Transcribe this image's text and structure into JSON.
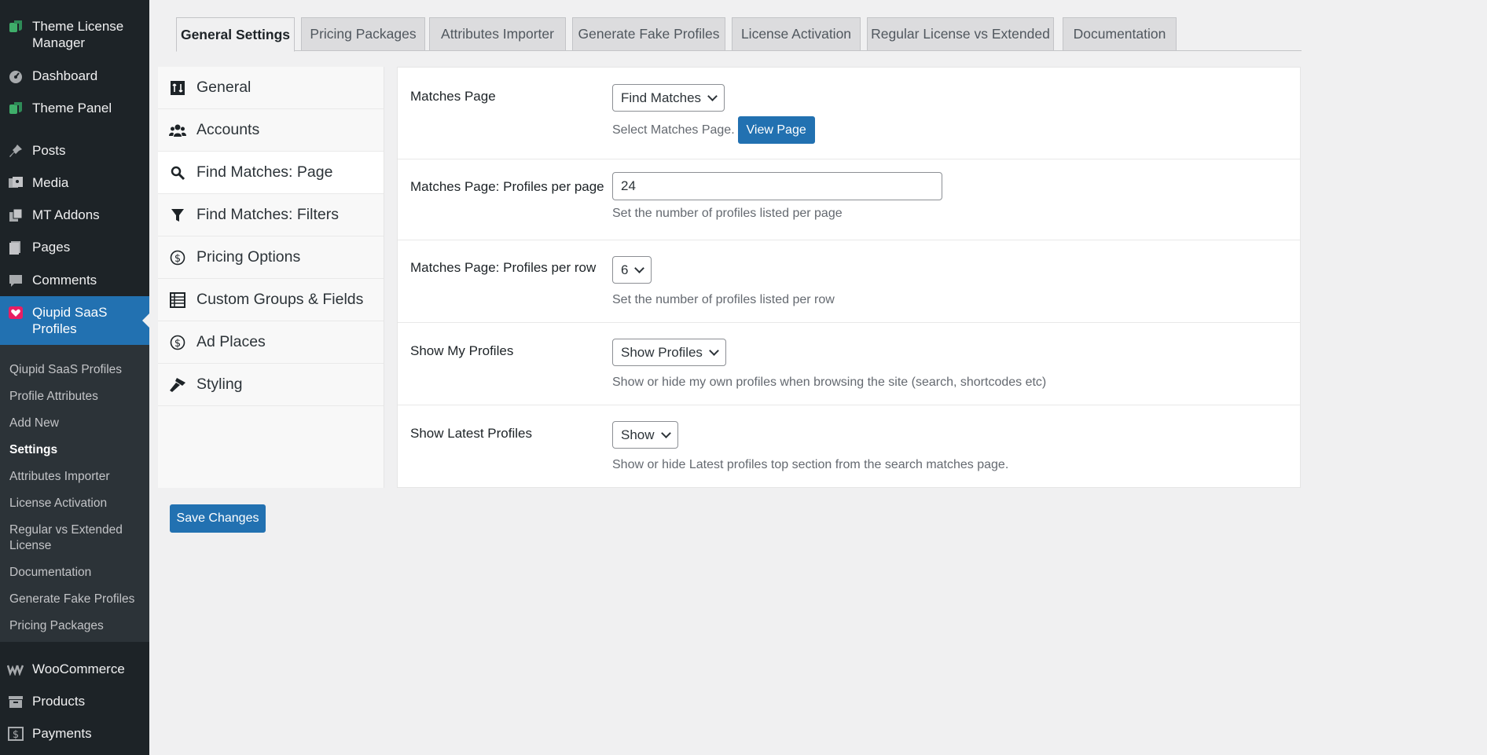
{
  "sidebar": {
    "top": [
      {
        "label": "Theme License Manager",
        "icon": "leaf-icon"
      },
      {
        "label": "Dashboard",
        "icon": "dashboard-icon"
      },
      {
        "label": "Theme Panel",
        "icon": "leaf-icon"
      },
      {
        "label": "Posts",
        "icon": "pin-icon"
      },
      {
        "label": "Media",
        "icon": "media-icon"
      },
      {
        "label": "MT Addons",
        "icon": "addons-icon"
      },
      {
        "label": "Pages",
        "icon": "pages-icon"
      },
      {
        "label": "Comments",
        "icon": "comment-icon"
      },
      {
        "label": "Qiupid SaaS Profiles",
        "icon": "heart-icon"
      }
    ],
    "submenu": [
      "Qiupid SaaS Profiles",
      "Profile Attributes",
      "Add New",
      "Settings",
      "Attributes Importer",
      "License Activation",
      "Regular vs Extended License",
      "Documentation",
      "Generate Fake Profiles",
      "Pricing Packages"
    ],
    "bottom": [
      {
        "label": "WooCommerce",
        "icon": "woo-icon"
      },
      {
        "label": "Products",
        "icon": "archive-icon"
      },
      {
        "label": "Payments",
        "icon": "dollar-box-icon"
      }
    ]
  },
  "tabs": [
    "General Settings",
    "Pricing Packages",
    "Attributes Importer",
    "Generate Fake Profiles",
    "License Activation",
    "Regular License vs Extended",
    "Documentation"
  ],
  "vnav": [
    "General",
    "Accounts",
    "Find Matches: Page",
    "Find Matches: Filters",
    "Pricing Options",
    "Custom Groups & Fields",
    "Ad Places",
    "Styling"
  ],
  "settings": {
    "matches_page": {
      "label": "Matches Page",
      "value": "Find Matches",
      "desc": "Select Matches Page.",
      "button": "View Page"
    },
    "per_page": {
      "label": "Matches Page: Profiles per page",
      "value": "24",
      "desc": "Set the number of profiles listed per page"
    },
    "per_row": {
      "label": "Matches Page: Profiles per row",
      "value": "6",
      "desc": "Set the number of profiles listed per row"
    },
    "show_my": {
      "label": "Show My Profiles",
      "value": "Show Profiles",
      "desc": "Show or hide my own profiles when browsing the site (search, shortcodes etc)"
    },
    "show_latest": {
      "label": "Show Latest Profiles",
      "value": "Show",
      "desc": "Show or hide Latest profiles top section from the search matches page."
    }
  },
  "save_label": "Save Changes",
  "colors": {
    "accent": "#2271b1",
    "sidebar_bg": "#1d2327",
    "heart": "#e91e63",
    "leaf": "#3fae6a"
  }
}
